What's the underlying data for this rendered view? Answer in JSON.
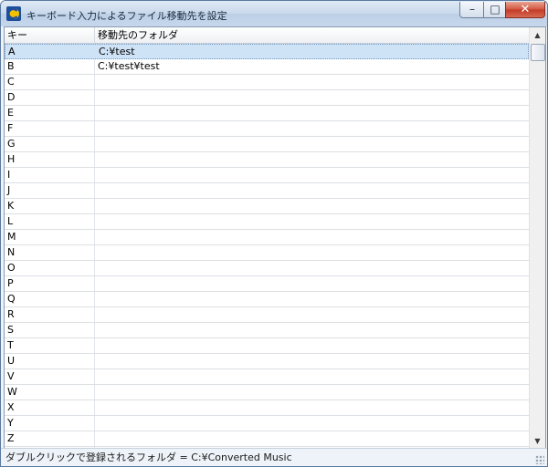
{
  "window": {
    "title": "キーボード入力によるファイル移動先を設定",
    "icon": "app-icon",
    "controls": {
      "minimize": "minimize-icon",
      "maximize": "maximize-icon",
      "close": "close-icon"
    }
  },
  "table": {
    "columns": [
      "キー",
      "移動先のフォルダ"
    ],
    "selected_row": 0,
    "rows": [
      {
        "key": "A",
        "folder": "C:¥test"
      },
      {
        "key": "B",
        "folder": "C:¥test¥test"
      },
      {
        "key": "C",
        "folder": ""
      },
      {
        "key": "D",
        "folder": ""
      },
      {
        "key": "E",
        "folder": ""
      },
      {
        "key": "F",
        "folder": ""
      },
      {
        "key": "G",
        "folder": ""
      },
      {
        "key": "H",
        "folder": ""
      },
      {
        "key": "I",
        "folder": ""
      },
      {
        "key": "J",
        "folder": ""
      },
      {
        "key": "K",
        "folder": ""
      },
      {
        "key": "L",
        "folder": ""
      },
      {
        "key": "M",
        "folder": ""
      },
      {
        "key": "N",
        "folder": ""
      },
      {
        "key": "O",
        "folder": ""
      },
      {
        "key": "P",
        "folder": ""
      },
      {
        "key": "Q",
        "folder": ""
      },
      {
        "key": "R",
        "folder": ""
      },
      {
        "key": "S",
        "folder": ""
      },
      {
        "key": "T",
        "folder": ""
      },
      {
        "key": "U",
        "folder": ""
      },
      {
        "key": "V",
        "folder": ""
      },
      {
        "key": "W",
        "folder": ""
      },
      {
        "key": "X",
        "folder": ""
      },
      {
        "key": "Y",
        "folder": ""
      },
      {
        "key": "Z",
        "folder": ""
      }
    ]
  },
  "status": {
    "text": "ダブルクリックで登録されるフォルダ = C:¥Converted Music"
  },
  "colors": {
    "selection": "#cfe3f7",
    "close_button": "#c23a24"
  }
}
